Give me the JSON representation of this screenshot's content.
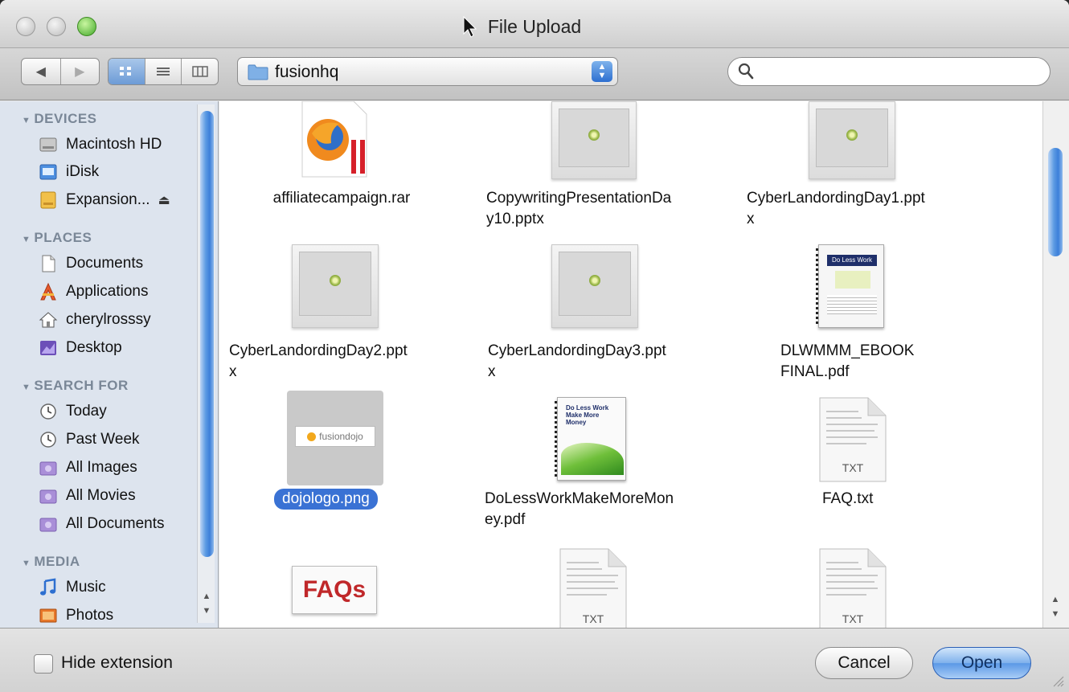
{
  "window": {
    "title": "File Upload"
  },
  "toolbar": {
    "location": "fusionhq",
    "search": {
      "value": "",
      "placeholder": ""
    }
  },
  "sidebar": {
    "sections": [
      {
        "heading": "DEVICES",
        "items": [
          {
            "label": "Macintosh HD",
            "icon": "hard-drive-icon"
          },
          {
            "label": "iDisk",
            "icon": "idisk-icon"
          },
          {
            "label": "Expansion...",
            "icon": "external-drive-icon",
            "eject": "⏏"
          }
        ]
      },
      {
        "heading": "PLACES",
        "items": [
          {
            "label": "Documents",
            "icon": "documents-folder-icon"
          },
          {
            "label": "Applications",
            "icon": "applications-icon"
          },
          {
            "label": "cherylrosssy",
            "icon": "home-icon"
          },
          {
            "label": "Desktop",
            "icon": "desktop-icon"
          }
        ]
      },
      {
        "heading": "SEARCH FOR",
        "items": [
          {
            "label": "Today",
            "icon": "clock-icon"
          },
          {
            "label": "Past Week",
            "icon": "clock-icon"
          },
          {
            "label": "All Images",
            "icon": "smart-folder-icon"
          },
          {
            "label": "All Movies",
            "icon": "smart-folder-icon"
          },
          {
            "label": "All Documents",
            "icon": "smart-folder-icon"
          }
        ]
      },
      {
        "heading": "MEDIA",
        "items": [
          {
            "label": "Music",
            "icon": "music-note-icon"
          },
          {
            "label": "Photos",
            "icon": "photos-icon"
          }
        ]
      }
    ]
  },
  "files": [
    {
      "name": "affiliatecampaign.rar",
      "kind": "rar"
    },
    {
      "name": "CopywritingPresentationDa\ny10.pptx",
      "kind": "pptx"
    },
    {
      "name": "CyberLandordingDay1.ppt\nx",
      "kind": "pptx"
    },
    {
      "name": "CyberLandordingDay2.ppt\nx",
      "kind": "pptx"
    },
    {
      "name": "CyberLandordingDay3.ppt\nx",
      "kind": "pptx"
    },
    {
      "name": "DLWMMM_EBOOK\nFINAL.pdf",
      "kind": "pdf",
      "cover_text": "Do Less Work"
    },
    {
      "name": "dojologo.png",
      "kind": "png",
      "selected": true,
      "logo_text": "fusiondojo"
    },
    {
      "name": "DoLessWorkMakeMoreMon\ney.pdf",
      "kind": "pdf",
      "cover_text": "Do Less Work Make More Money"
    },
    {
      "name": "FAQ.txt",
      "kind": "txt",
      "badge": "TXT"
    },
    {
      "name": "",
      "kind": "image",
      "badge": "FAQs"
    },
    {
      "name": "",
      "kind": "txt",
      "badge": "TXT"
    },
    {
      "name": "",
      "kind": "txt",
      "badge": "TXT"
    }
  ],
  "bottom": {
    "hide_extension_label": "Hide extension",
    "cancel_label": "Cancel",
    "open_label": "Open"
  },
  "colors": {
    "selection": "#3a72d4",
    "sidebar_bg": "#dde4ee",
    "accent_blue": "#5a98e6"
  }
}
